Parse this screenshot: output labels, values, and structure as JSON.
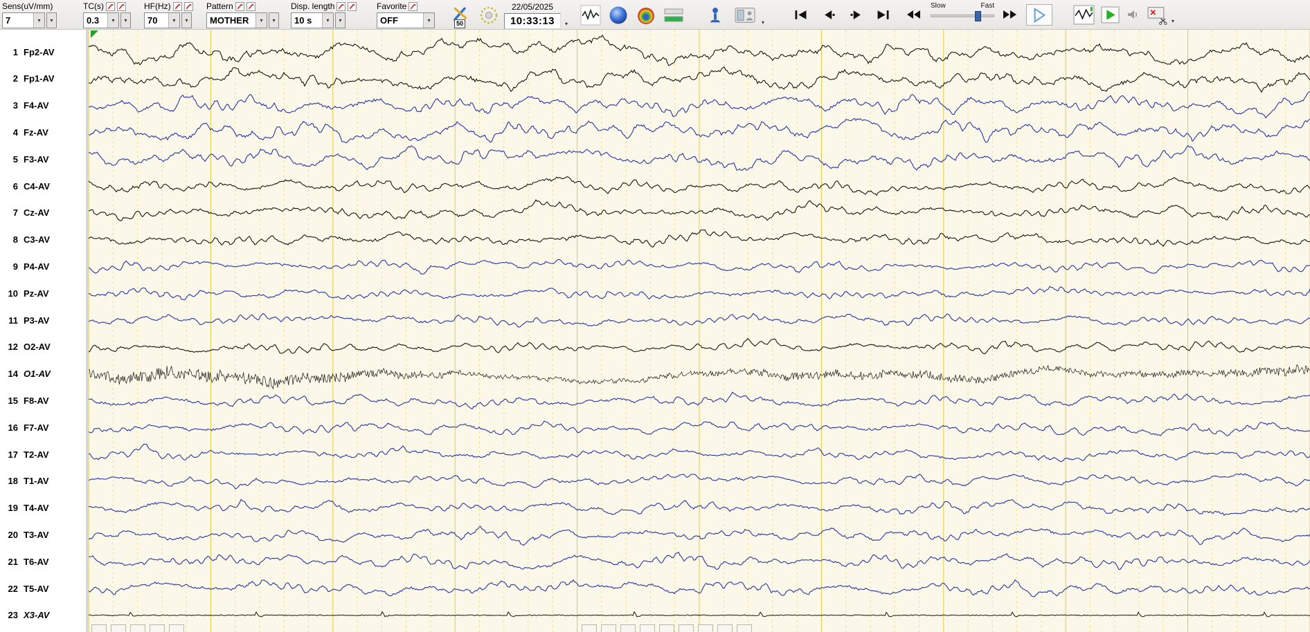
{
  "toolbar": {
    "sens": {
      "label": "Sens(uV/mm)",
      "value": "7"
    },
    "tc": {
      "label": "TC(s)",
      "value": "0.3"
    },
    "hf": {
      "label": "HF(Hz)",
      "value": "70"
    },
    "pattern": {
      "label": "Pattern",
      "value": "MOTHER"
    },
    "disp_length": {
      "label": "Disp. length",
      "value": "10 s"
    },
    "favorite": {
      "label": "Favorite",
      "value": "OFF"
    },
    "notch_badge": "50",
    "date": "22/05/2025",
    "time": "10:33:13",
    "speed_slow": "Slow",
    "speed_fast": "Fast"
  },
  "channels": [
    {
      "num": "1",
      "label": "Fp2-AV",
      "color": "#141414",
      "italic": false,
      "wave": {
        "type": "eeg",
        "slow": 8,
        "mid": 5,
        "alpha": 3,
        "noise": 1.6
      }
    },
    {
      "num": "2",
      "label": "Fp1-AV",
      "color": "#141414",
      "italic": false,
      "wave": {
        "type": "eeg",
        "slow": 8,
        "mid": 5,
        "alpha": 3,
        "noise": 1.6
      }
    },
    {
      "num": "3",
      "label": "F4-AV",
      "color": "#2634a4",
      "italic": false,
      "wave": {
        "type": "eeg",
        "slow": 7,
        "mid": 5.5,
        "alpha": 4,
        "noise": 1.1
      }
    },
    {
      "num": "4",
      "label": "Fz-AV",
      "color": "#2634a4",
      "italic": false,
      "wave": {
        "type": "eeg",
        "slow": 7.5,
        "mid": 6,
        "alpha": 4,
        "noise": 1.1
      }
    },
    {
      "num": "5",
      "label": "F3-AV",
      "color": "#2634a4",
      "italic": false,
      "wave": {
        "type": "eeg",
        "slow": 7,
        "mid": 5.5,
        "alpha": 4,
        "noise": 1.1
      }
    },
    {
      "num": "6",
      "label": "C4-AV",
      "color": "#141414",
      "italic": false,
      "wave": {
        "type": "eeg",
        "slow": 4.5,
        "mid": 3.5,
        "alpha": 3,
        "noise": 1.2
      }
    },
    {
      "num": "7",
      "label": "Cz-AV",
      "color": "#141414",
      "italic": false,
      "wave": {
        "type": "eeg",
        "slow": 5,
        "mid": 3.5,
        "alpha": 3,
        "noise": 1.2
      }
    },
    {
      "num": "8",
      "label": "C3-AV",
      "color": "#141414",
      "italic": false,
      "wave": {
        "type": "eeg",
        "slow": 4.5,
        "mid": 3.5,
        "alpha": 3,
        "noise": 1.2
      }
    },
    {
      "num": "9",
      "label": "P4-AV",
      "color": "#2634a4",
      "italic": false,
      "wave": {
        "type": "eeg",
        "slow": 3.5,
        "mid": 3,
        "alpha": 3,
        "noise": 0.9
      }
    },
    {
      "num": "10",
      "label": "Pz-AV",
      "color": "#2634a4",
      "italic": false,
      "wave": {
        "type": "eeg",
        "slow": 3.5,
        "mid": 3,
        "alpha": 3,
        "noise": 0.9
      }
    },
    {
      "num": "11",
      "label": "P3-AV",
      "color": "#2634a4",
      "italic": false,
      "wave": {
        "type": "eeg",
        "slow": 3.5,
        "mid": 3,
        "alpha": 3,
        "noise": 0.9
      }
    },
    {
      "num": "12",
      "label": "O2-AV",
      "color": "#141414",
      "italic": false,
      "wave": {
        "type": "eeg",
        "slow": 3.5,
        "mid": 3,
        "alpha": 3.5,
        "noise": 1
      }
    },
    {
      "num": "14",
      "label": "O1-AV",
      "color": "#141414",
      "italic": true,
      "wave": {
        "type": "emg",
        "slow": 3,
        "mid": 2,
        "alpha": 1,
        "noise": 9
      }
    },
    {
      "num": "15",
      "label": "F8-AV",
      "color": "#2634a4",
      "italic": false,
      "wave": {
        "type": "eeg",
        "slow": 4.5,
        "mid": 3.5,
        "alpha": 3,
        "noise": 1
      }
    },
    {
      "num": "16",
      "label": "F7-AV",
      "color": "#2634a4",
      "italic": false,
      "wave": {
        "type": "eeg",
        "slow": 4.5,
        "mid": 3.5,
        "alpha": 3,
        "noise": 1
      }
    },
    {
      "num": "17",
      "label": "T2-AV",
      "color": "#2634a4",
      "italic": false,
      "wave": {
        "type": "eeg",
        "slow": 4,
        "mid": 3,
        "alpha": 2.5,
        "noise": 0.9
      }
    },
    {
      "num": "18",
      "label": "T1-AV",
      "color": "#2634a4",
      "italic": false,
      "wave": {
        "type": "eeg",
        "slow": 4,
        "mid": 3,
        "alpha": 2.5,
        "noise": 0.9
      }
    },
    {
      "num": "19",
      "label": "T4-AV",
      "color": "#2634a4",
      "italic": false,
      "wave": {
        "type": "eeg",
        "slow": 4.5,
        "mid": 3.5,
        "alpha": 3,
        "noise": 1
      }
    },
    {
      "num": "20",
      "label": "T3-AV",
      "color": "#2634a4",
      "italic": false,
      "wave": {
        "type": "eeg",
        "slow": 4.5,
        "mid": 3.5,
        "alpha": 3,
        "noise": 1
      }
    },
    {
      "num": "21",
      "label": "T6-AV",
      "color": "#2634a4",
      "italic": false,
      "wave": {
        "type": "eeg",
        "slow": 4.5,
        "mid": 3.5,
        "alpha": 3.5,
        "noise": 1
      }
    },
    {
      "num": "22",
      "label": "T5-AV",
      "color": "#2634a4",
      "italic": false,
      "wave": {
        "type": "eeg",
        "slow": 4.5,
        "mid": 3.5,
        "alpha": 3.5,
        "noise": 1
      }
    },
    {
      "num": "23",
      "label": "X3-AV",
      "color": "#141414",
      "italic": true,
      "wave": {
        "type": "flat",
        "slow": 0.5,
        "mid": 0,
        "alpha": 0,
        "noise": 0.5
      }
    }
  ]
}
